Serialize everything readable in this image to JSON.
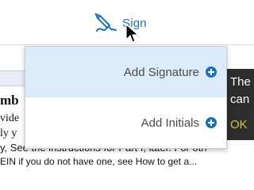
{
  "toolbar": {
    "sign_label": "Sign",
    "sign_icon": "signature-pen-icon"
  },
  "menu": {
    "items": [
      {
        "label": "Add Signature",
        "icon": "plus-circle-icon"
      },
      {
        "label": "Add Initials",
        "icon": "plus-circle-icon"
      }
    ]
  },
  "document": {
    "heading": "mb",
    "line1": "vide",
    "line2": "ly y",
    "line3": "y, See the instructions for Part I, later. For oth",
    "line4": "EIN if you do not have one, see How to get a..."
  },
  "dark_panel": {
    "line1": "The",
    "line2": "can",
    "ok": "OK"
  },
  "colors": {
    "accent": "#1f6fb2",
    "menu_highlight": "#dcebf9",
    "ok_text": "#d8c23a"
  }
}
